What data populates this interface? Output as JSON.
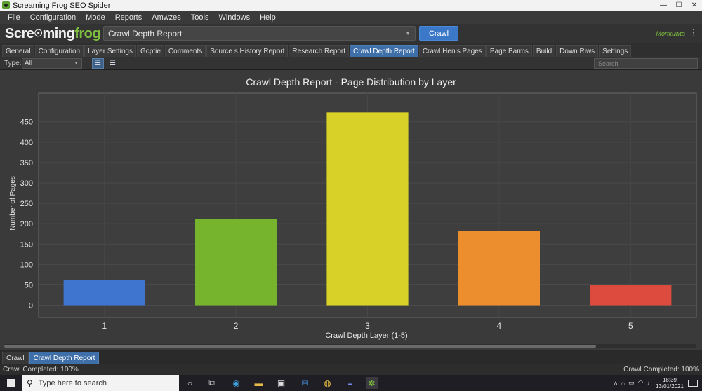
{
  "window": {
    "title": "Screaming Frog SEO Spider",
    "controls": [
      "—",
      "☐",
      "✕"
    ]
  },
  "menu": [
    "File",
    "Configuration",
    "Mode",
    "Reports",
    "Amwzes",
    "Tools",
    "Windows",
    "Help"
  ],
  "toolbar": {
    "logo_part1": "Scre",
    "logo_o": "☉",
    "logo_part2": "ming",
    "logo_part3": "frog",
    "url_value": "Crawl Depth Report",
    "crawl_label": "Crawl",
    "user_label": "Mortkuwta"
  },
  "tabs": [
    {
      "label": "General",
      "active": false
    },
    {
      "label": "Configuration",
      "active": false
    },
    {
      "label": "Layer Settings",
      "active": false
    },
    {
      "label": "Gcptie",
      "active": false
    },
    {
      "label": "Comments",
      "active": false
    },
    {
      "label": "Source s History Report",
      "active": false
    },
    {
      "label": "Research Report",
      "active": false
    },
    {
      "label": "Crawl Depth Report",
      "active": true
    },
    {
      "label": "Crawl Henls Pages",
      "active": false
    },
    {
      "label": "Page Barms",
      "active": false
    },
    {
      "label": "Build",
      "active": false
    },
    {
      "label": "Down Riws",
      "active": false
    },
    {
      "label": "Settings",
      "active": false
    }
  ],
  "filter": {
    "type_label": "Type:",
    "type_value": "All",
    "search_placeholder": "Search"
  },
  "chart_data": {
    "type": "bar",
    "title": "Crawl Depth Report - Page Distribution by Layer",
    "xlabel": "Crawl Depth Layer (1-5)",
    "ylabel": "Number of Pages",
    "categories": [
      "1",
      "2",
      "3",
      "4",
      "5"
    ],
    "values": [
      62,
      211,
      473,
      182,
      49
    ],
    "colors": [
      "#3f74cf",
      "#77b42e",
      "#d8d228",
      "#ec8e2e",
      "#dc4b3e"
    ],
    "yticks": [
      0,
      50,
      100,
      150,
      200,
      250,
      300,
      350,
      400,
      450
    ],
    "ytick_labels": [
      "0",
      "50",
      "100",
      "150",
      "200",
      "250",
      "300",
      "350",
      "400",
      "450"
    ],
    "ylim": [
      -30,
      520
    ],
    "grid": true
  },
  "bottom_tabs": [
    {
      "label": "Crawl",
      "active": false
    },
    {
      "label": "Crawl Depth Report",
      "active": true
    }
  ],
  "status": {
    "left": "Crawl Completed: 100%",
    "right": "Crawl Completed: 100%"
  },
  "taskbar": {
    "search_placeholder": "Type here to search",
    "time": "18:39",
    "date": "13/01/2021",
    "icons": [
      "cortana-icon",
      "task-view-icon",
      "edge-icon",
      "file-explorer-icon",
      "store-icon",
      "mail-icon",
      "chrome-icon",
      "discord-icon",
      "screaming-frog-icon"
    ]
  }
}
